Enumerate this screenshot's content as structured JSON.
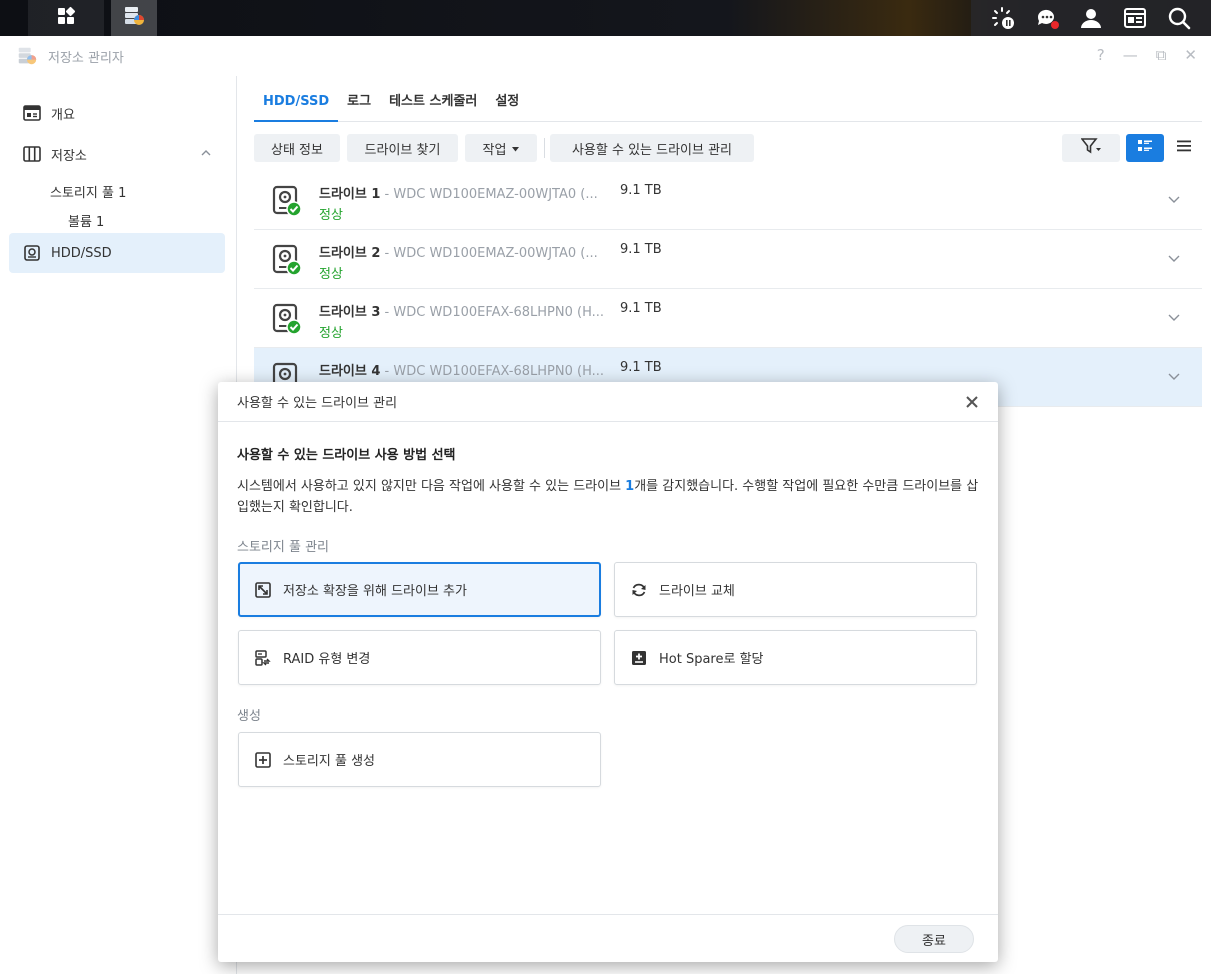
{
  "window": {
    "title": "저장소 관리자"
  },
  "window_controls": {
    "help": "?",
    "minimize": "—",
    "restore": "⧉",
    "close": "✕"
  },
  "sidebar": {
    "items": [
      {
        "label": "개요"
      },
      {
        "label": "저장소"
      },
      {
        "label": "스토리지 풀 1"
      },
      {
        "label": "볼륨 1"
      },
      {
        "label": "HDD/SSD"
      }
    ]
  },
  "tabs": [
    {
      "label": "HDD/SSD"
    },
    {
      "label": "로그"
    },
    {
      "label": "테스트 스케줄러"
    },
    {
      "label": "설정"
    }
  ],
  "toolbar": {
    "status_info": "상태 정보",
    "find_drive": "드라이브 찾기",
    "action": "작업",
    "manage_available": "사용할 수 있는 드라이브 관리"
  },
  "drives": [
    {
      "name": "드라이브 1",
      "model": " - WDC WD100EMAZ-00WJTA0 (...",
      "size": "9.1 TB",
      "status": "정상"
    },
    {
      "name": "드라이브 2",
      "model": " - WDC WD100EMAZ-00WJTA0 (...",
      "size": "9.1 TB",
      "status": "정상"
    },
    {
      "name": "드라이브 3",
      "model": " - WDC WD100EFAX-68LHPN0 (H...",
      "size": "9.1 TB",
      "status": "정상"
    },
    {
      "name": "드라이브 4",
      "model": " - WDC WD100EFAX-68LHPN0 (H...",
      "size": "9.1 TB",
      "status": ""
    }
  ],
  "modal": {
    "title": "사용할 수 있는 드라이브 관리",
    "heading": "사용할 수 있는 드라이브 사용 방법 선택",
    "desc_before": "시스템에서 사용하고 있지 않지만 다음 작업에 사용할 수 있는 드라이브 ",
    "desc_count": "1",
    "desc_after": "개를 감지했습니다. 수행할 작업에 필요한 수만큼 드라이브를 삽입했는지 확인합니다.",
    "section_pool": "스토리지 풀 관리",
    "section_create": "생성",
    "options": {
      "expand": "저장소 확장을 위해 드라이브 추가",
      "replace": "드라이브 교체",
      "raid": "RAID 유형 변경",
      "hotspare": "Hot Spare로 할당",
      "create_pool": "스토리지 풀 생성"
    },
    "close_label": "종료"
  },
  "colors": {
    "accent": "#1a7de0",
    "ok": "#24a32e",
    "notify": "#e8282b"
  },
  "icons": {
    "taskbar": [
      "apps-icon",
      "storage-manager-icon",
      "update-status-icon",
      "chat-icon",
      "user-icon",
      "widgets-icon",
      "search-icon"
    ]
  }
}
